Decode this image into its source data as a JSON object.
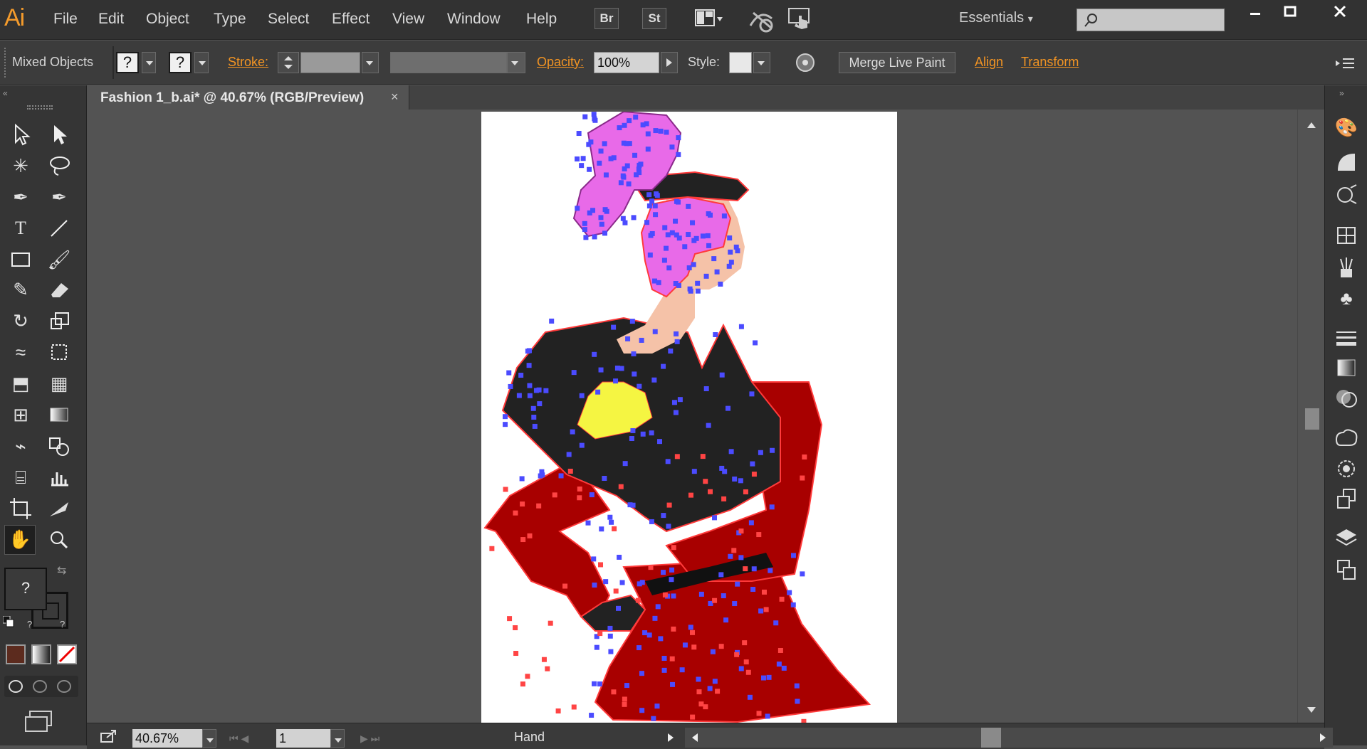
{
  "app": {
    "logo": "Ai",
    "workspace": "Essentials"
  },
  "menu": [
    "File",
    "Edit",
    "Object",
    "Type",
    "Select",
    "Effect",
    "View",
    "Window",
    "Help"
  ],
  "menubar_buttons": [
    "Br",
    "St"
  ],
  "control": {
    "selection_label": "Mixed Objects",
    "fill_value": "?",
    "stroke_value": "?",
    "stroke_label": "Stroke:",
    "opacity_label": "Opacity:",
    "opacity_value": "100%",
    "style_label": "Style:",
    "merge_button": "Merge Live Paint",
    "align_link": "Align",
    "transform_link": "Transform"
  },
  "document": {
    "tab_title": "Fashion 1_b.ai* @ 40.67% (RGB/Preview)",
    "close": "×"
  },
  "toolbox": {
    "fill_stroke_value": "?"
  },
  "status": {
    "zoom": "40.67%",
    "page": "1",
    "tool": "Hand"
  },
  "colors": {
    "accent": "#f29423",
    "canvas_bg": "#535353",
    "dress_red": "#a80000",
    "jacket_black": "#222222",
    "skin": "#f5c2a8",
    "hair_pink": "#e86ae8",
    "bodice_yellow": "#f5f542",
    "anchor_blue": "#4b4bff",
    "anchor_red": "#ff4444"
  }
}
